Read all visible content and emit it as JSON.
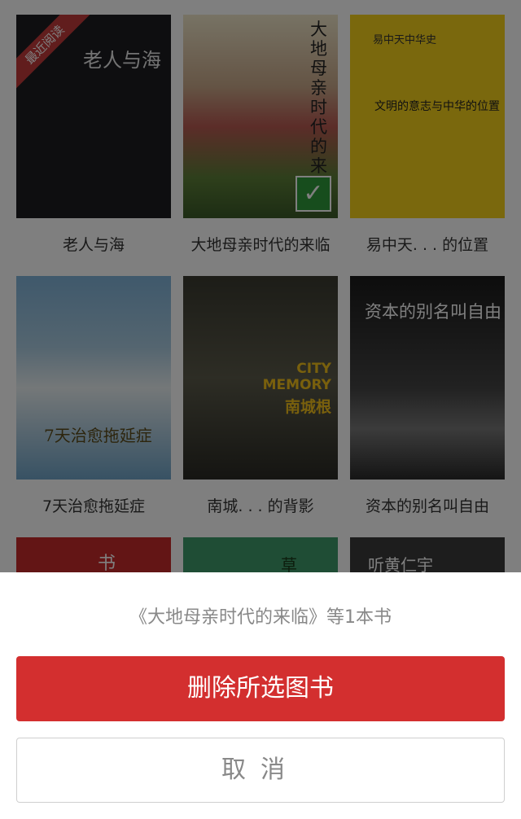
{
  "books": [
    {
      "title": "老人与海",
      "cover_text": "老人与海",
      "badge": "最近阅读"
    },
    {
      "title": "大地母亲时代的来临",
      "cover_text": "大地母亲时代的来临",
      "selected": true
    },
    {
      "title": "易中天. . . 的位置",
      "cover_text": "文明的意志与中华的位置",
      "cover_series": "易中天中华史"
    },
    {
      "title": "7天治愈拖延症",
      "cover_text": "7天治愈拖延症"
    },
    {
      "title": "南城. . . 的背影",
      "cover_text": "CITY MEMORY",
      "cover_subtitle": "南城根"
    },
    {
      "title": "资本的别名叫自由",
      "cover_text": "资本的别名叫自由"
    },
    {
      "title": "",
      "cover_text": "书"
    },
    {
      "title": "",
      "cover_text": "草"
    },
    {
      "title": "",
      "cover_text": "听黄仁宇"
    }
  ],
  "sheet": {
    "message": "《大地母亲时代的来临》等1本书",
    "delete_label": "删除所选图书",
    "cancel_label": "取消"
  },
  "colors": {
    "accent": "#d32f2f",
    "check": "#2e9a3a"
  }
}
